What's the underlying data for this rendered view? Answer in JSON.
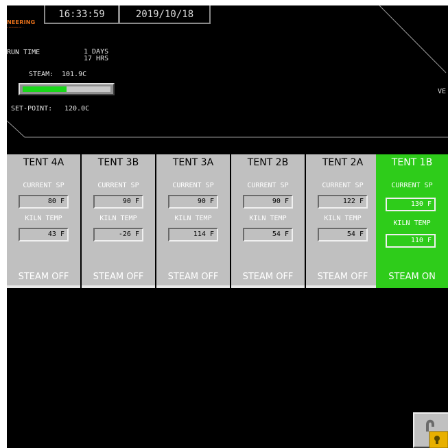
{
  "header": {
    "logo_text": "NEERING",
    "logo_sub": "A DIVISION OF ...",
    "time": "16:33:59",
    "date": "2019/10/18"
  },
  "status": {
    "run_time_label": "RUN TIME",
    "run_days": "1 DAYS",
    "run_hrs": "17 HRS",
    "steam_label": "STEAM:",
    "steam_value": "101.9C",
    "steam_level": 0.5,
    "setpoint_label": "SET-POINT:",
    "setpoint_value": "120.0C",
    "right_label": "VE"
  },
  "tents": [
    {
      "title": "TENT 4A",
      "sp_label": "CURRENT SP",
      "sp": "80 F",
      "kiln_label": "KILN TEMP",
      "kiln": "43 F",
      "status": "STEAM OFF",
      "active": false
    },
    {
      "title": "TENT 3B",
      "sp_label": "CURRENT SP",
      "sp": "90 F",
      "kiln_label": "KILN TEMP",
      "kiln": "-26 F",
      "status": "STEAM OFF",
      "active": false
    },
    {
      "title": "TENT 3A",
      "sp_label": "CURRENT SP",
      "sp": "90 F",
      "kiln_label": "KILN TEMP",
      "kiln": "114 F",
      "status": "STEAM OFF",
      "active": false
    },
    {
      "title": "TENT 2B",
      "sp_label": "CURRENT SP",
      "sp": "90 F",
      "kiln_label": "KILN TEMP",
      "kiln": "54 F",
      "status": "STEAM OFF",
      "active": false
    },
    {
      "title": "TENT 2A",
      "sp_label": "CURRENT SP",
      "sp": "122 F",
      "kiln_label": "KILN TEMP",
      "kiln": "54 F",
      "status": "STEAM OFF",
      "active": false
    },
    {
      "title": "TENT 1B",
      "sp_label": "CURRENT SP",
      "sp": "130 F",
      "kiln_label": "KILN TEMP",
      "kiln": "110 F",
      "status": "STEAM ON",
      "active": true
    }
  ],
  "colors": {
    "screen_bg": "#000000",
    "panel_gray": "#c0c0c0",
    "active_green": "#2ecc1a",
    "gauge_green": "#1ad61a",
    "logo_orange": "#e8701a"
  },
  "icons": {
    "lock": "unlocked-padlock-icon"
  }
}
